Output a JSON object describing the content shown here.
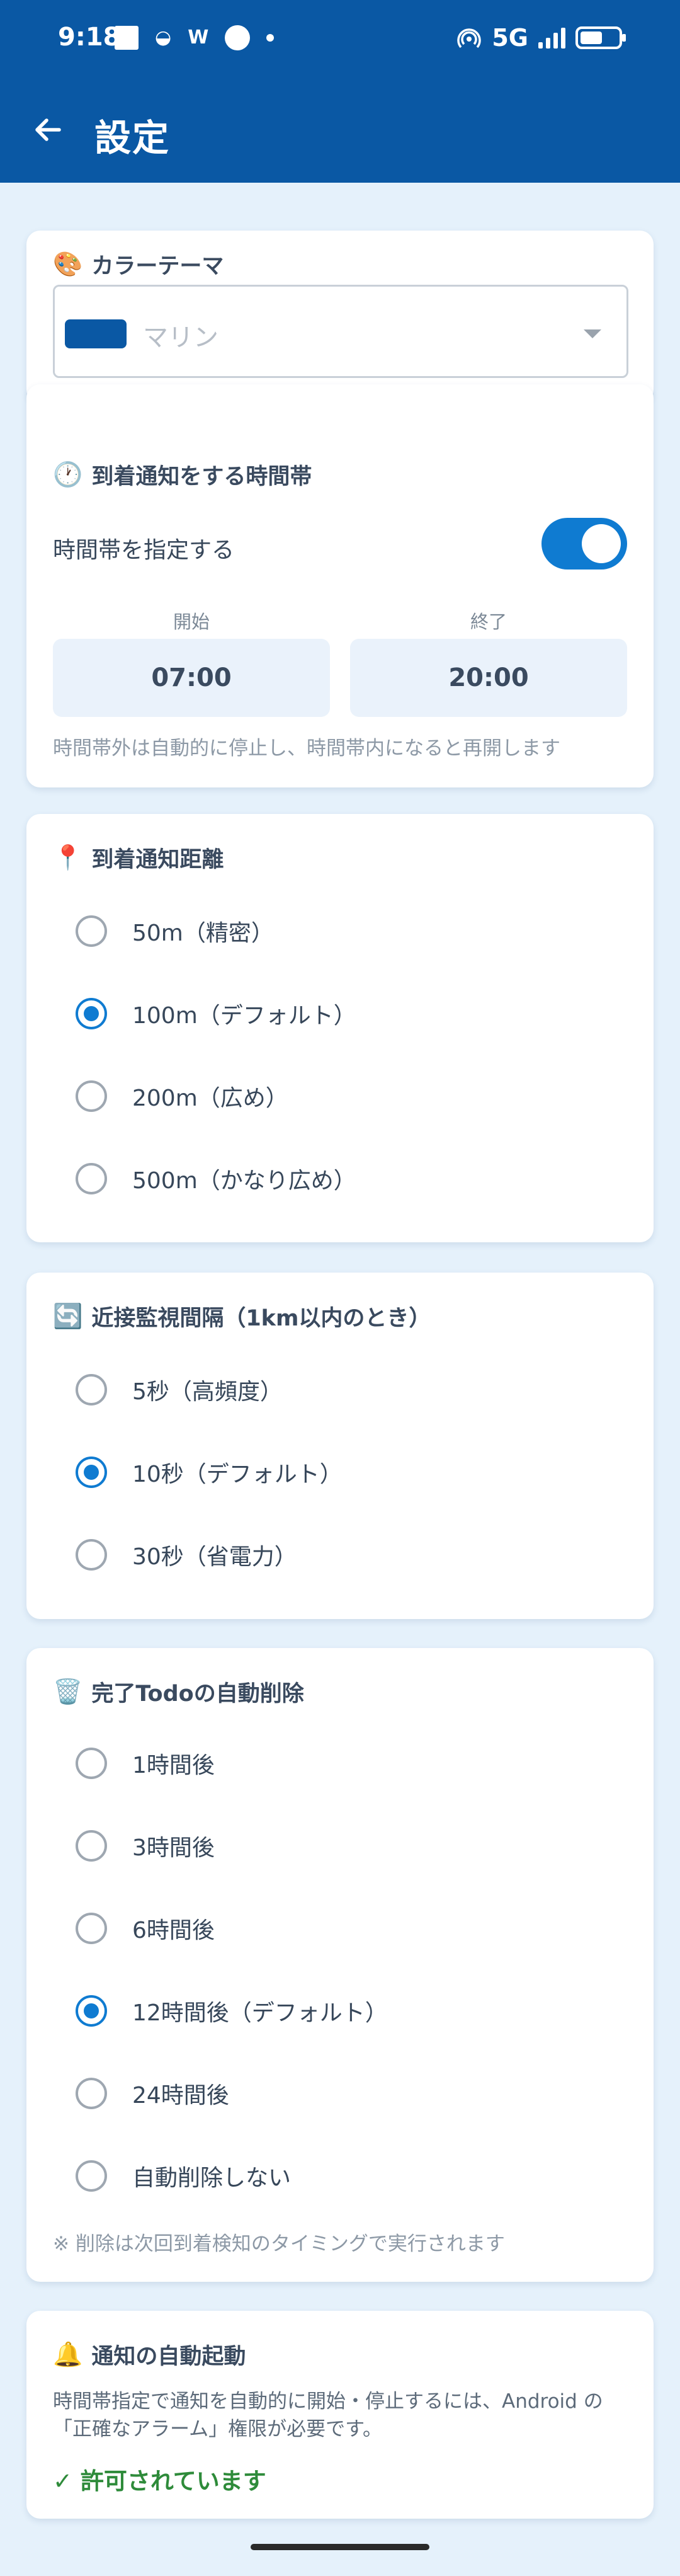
{
  "status_bar": {
    "time": "9:18",
    "network": "5G",
    "notification_glyph_1": "◒",
    "notification_glyph_2": "W"
  },
  "app_bar": {
    "title": "設定",
    "back_icon": "arrow-left-icon"
  },
  "color_theme": {
    "icon": "🎨",
    "title": "カラーテーマ",
    "selected": "マリン",
    "swatch_color": "#0a58a4"
  },
  "time_window": {
    "icon": "🕐",
    "title": "到着通知をする時間帯",
    "toggle_label": "時間帯を指定する",
    "toggle_on": true,
    "start_label": "開始",
    "start_value": "07:00",
    "end_label": "終了",
    "end_value": "20:00",
    "hint": "時間帯外は自動的に停止し、時間帯内になると再開します"
  },
  "distance": {
    "icon": "📍",
    "title": "到着通知距離",
    "options": [
      "50m（精密）",
      "100m（デフォルト）",
      "200m（広め）",
      "500m（かなり広め）"
    ],
    "selected_index": 1
  },
  "interval": {
    "icon": "🔄",
    "title": "近接監視間隔（1km以内のとき）",
    "options": [
      "5秒（高頻度）",
      "10秒（デフォルト）",
      "30秒（省電力）"
    ],
    "selected_index": 1
  },
  "auto_delete": {
    "icon": "🗑️",
    "title": "完了Todoの自動削除",
    "options": [
      "1時間後",
      "3時間後",
      "6時間後",
      "12時間後（デフォルト）",
      "24時間後",
      "自動削除しない"
    ],
    "selected_index": 3,
    "hint": "※ 削除は次回到着検知のタイミングで実行されます"
  },
  "auto_start": {
    "icon": "🔔",
    "title": "通知の自動起動",
    "description": "時間帯指定で通知を自動的に開始・停止するには、Android の「正確なアラーム」権限が必要です。",
    "status": "✓ 許可されています"
  },
  "colors": {
    "primary": "#0a58a4",
    "accent": "#0f7bd1",
    "background": "#e5f1fb",
    "success": "#2e8b3a"
  }
}
